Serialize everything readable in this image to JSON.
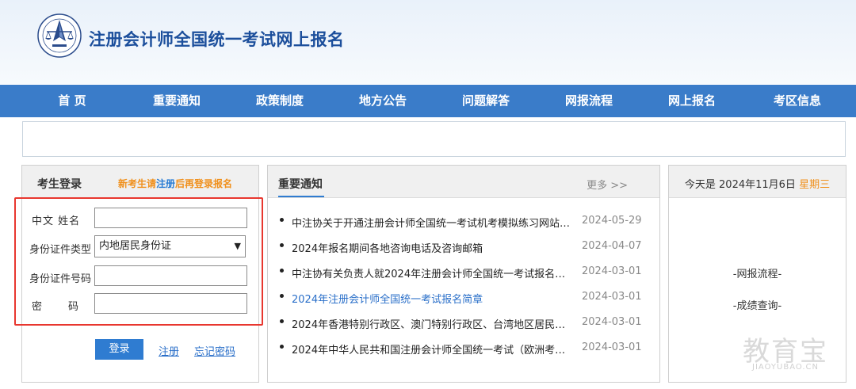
{
  "header": {
    "site_title": "注册会计师全国统一考试网上报名",
    "logo_icon": "cicpa-emblem-icon"
  },
  "nav": {
    "items": [
      {
        "label": "首 页"
      },
      {
        "label": "重要通知"
      },
      {
        "label": "政策制度"
      },
      {
        "label": "地方公告"
      },
      {
        "label": "问题解答"
      },
      {
        "label": "网报流程"
      },
      {
        "label": "网上报名"
      },
      {
        "label": "考区信息"
      }
    ]
  },
  "login": {
    "title": "考生登录",
    "hint_prefix": "新考生请",
    "hint_link": "注册",
    "hint_suffix": "后再登录报名",
    "fields": {
      "name_label": "中文  姓名",
      "name_value": "",
      "id_type_label": "身份证件类型",
      "id_type_value": "内地居民身份证",
      "id_number_label": "身份证件号码",
      "id_number_value": "",
      "password_label": "密        码",
      "password_value": ""
    },
    "login_button": "登录",
    "register_link": "注册",
    "forgot_link": "忘记密码"
  },
  "notice": {
    "title": "重要通知",
    "more": "更多 >>",
    "items": [
      {
        "title": "中注协关于开通注册会计师全国统一考试机考模拟练习网站的公...",
        "date": "2024-05-29",
        "highlight": false
      },
      {
        "title": "2024年报名期间各地咨询电话及咨询邮箱",
        "date": "2024-04-07",
        "highlight": false
      },
      {
        "title": "中注协有关负责人就2024年注册会计师全国统一考试报名相...",
        "date": "2024-03-01",
        "highlight": false
      },
      {
        "title": "2024年注册会计师全国统一考试报名简章",
        "date": "2024-03-01",
        "highlight": true
      },
      {
        "title": "2024年香港特别行政区、澳门特别行政区、台湾地区居民及...",
        "date": "2024-03-01",
        "highlight": false
      },
      {
        "title": "2024年中华人民共和国注册会计师全国统一考试（欧洲考区...",
        "date": "2024-03-01",
        "highlight": false
      }
    ]
  },
  "date_panel": {
    "today_text": "今天是 2024年11月6日",
    "weekday": "星期三",
    "links": [
      "-网报流程-",
      "-成绩查询-"
    ]
  },
  "watermark": {
    "cn": "教育宝",
    "en": "JIAOYUBAO.CN"
  },
  "colors": {
    "nav_bg": "#3a7cc9",
    "title_blue": "#1c4f9c",
    "accent_orange": "#f0901c",
    "link_blue": "#2a6fc9",
    "highlight_red": "#e8372f"
  }
}
